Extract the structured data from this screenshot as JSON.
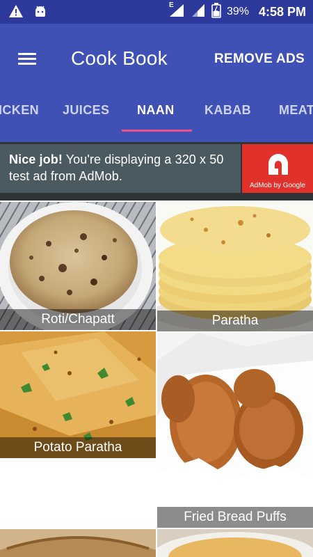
{
  "status_bar": {
    "battery_percent": "39%",
    "clock": "4:58 PM",
    "network_label": "E",
    "icons": [
      "warning-icon",
      "android-icon",
      "signal-icon",
      "signal-icon",
      "battery-icon"
    ]
  },
  "app_bar": {
    "title": "Cook Book",
    "remove_ads_label": "REMOVE ADS",
    "color": "#3f51b5",
    "status_color": "#2d3a9c"
  },
  "tabs": [
    {
      "label": "ICKEN",
      "active": false
    },
    {
      "label": "JUICES",
      "active": false
    },
    {
      "label": "NAAN",
      "active": true
    },
    {
      "label": "KABAB",
      "active": false
    },
    {
      "label": "MEAT",
      "active": false
    }
  ],
  "ad": {
    "bold": "Nice job!",
    "line1": " You're displaying a 320 x 50",
    "line2": "test ad from AdMob.",
    "logo_caption": "AdMob by Google",
    "accent": "#e2312b"
  },
  "recipes": [
    {
      "name": "Roti/Chapatt"
    },
    {
      "name": "Paratha"
    },
    {
      "name": "Potato Paratha"
    },
    {
      "name": "Fried Bread Puffs"
    },
    {
      "name": ""
    },
    {
      "name": ""
    }
  ],
  "accent_indicator": "#f0508a"
}
